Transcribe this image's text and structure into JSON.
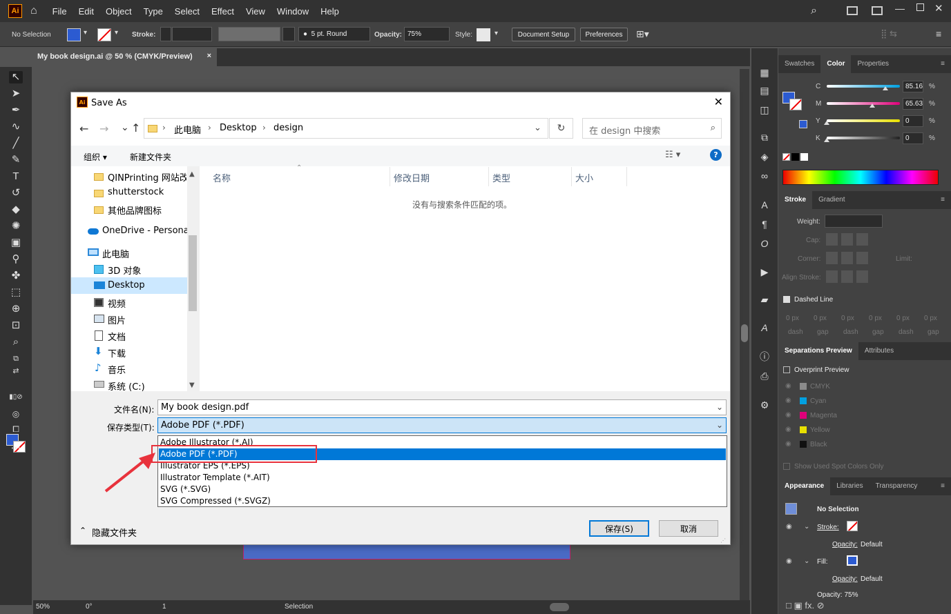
{
  "app": {
    "logo": "Ai",
    "menu": [
      "File",
      "Edit",
      "Object",
      "Type",
      "Select",
      "Effect",
      "View",
      "Window",
      "Help"
    ]
  },
  "control_bar": {
    "selection": "No Selection",
    "stroke_label": "Stroke:",
    "brush": "5 pt. Round",
    "opacity_label": "Opacity:",
    "opacity_value": "75%",
    "style_label": "Style:",
    "document_setup": "Document Setup",
    "preferences": "Preferences",
    "fill_color": "#2c5bd1"
  },
  "document_tab": {
    "title": "My book design.ai @ 50 % (CMYK/Preview)",
    "close": "×"
  },
  "status_bar": {
    "zoom": "50%",
    "rotation": "0°",
    "artboard": "1",
    "tool": "Selection"
  },
  "panels": {
    "color_tabs": [
      "Swatches",
      "Color",
      "Properties"
    ],
    "color": {
      "channels": [
        {
          "k": "C",
          "v": "85.16",
          "c": "#00a0e0"
        },
        {
          "k": "M",
          "v": "65.63",
          "c": "#e0007a"
        },
        {
          "k": "Y",
          "v": "0",
          "c": "#e8e000"
        },
        {
          "k": "K",
          "v": "0",
          "c": "#222222"
        }
      ],
      "unit": "%"
    },
    "stroke_tabs": [
      "Stroke",
      "Gradient"
    ],
    "stroke": {
      "weight": "Weight:",
      "cap": "Cap:",
      "corner": "Corner:",
      "limit": "Limit:",
      "align": "Align Stroke:",
      "dashed": "Dashed Line",
      "dash_vals": [
        "0 px",
        "0 px",
        "0 px",
        "0 px",
        "0 px",
        "0 px"
      ],
      "dash_labels": [
        "dash",
        "gap",
        "dash",
        "gap",
        "dash",
        "gap"
      ]
    },
    "sep_tabs": [
      "Separations Preview",
      "Attributes"
    ],
    "separations": {
      "overprint": "Overprint Preview",
      "inks": [
        {
          "n": "CMYK",
          "c": "#8a8a8a"
        },
        {
          "n": "Cyan",
          "c": "#00a0e0"
        },
        {
          "n": "Magenta",
          "c": "#e0007a"
        },
        {
          "n": "Yellow",
          "c": "#e8e000"
        },
        {
          "n": "Black",
          "c": "#111111"
        }
      ],
      "spot": "Show Used Spot Colors Only"
    },
    "app_tabs": [
      "Appearance",
      "Libraries",
      "Transparency"
    ],
    "appearance": {
      "title": "No Selection",
      "stroke": "Stroke:",
      "opacity": "Opacity:",
      "default": "Default",
      "fill": "Fill:",
      "opacity_bottom": "Opacity: 75%"
    }
  },
  "dialog": {
    "title": "Save As",
    "breadcrumb": [
      "此电脑",
      "Desktop",
      "design"
    ],
    "search_placeholder": "在 design 中搜索",
    "organize": "组织 ▾",
    "new_folder": "新建文件夹",
    "nav_items": [
      "QINPrinting 网站改",
      "shutterstock",
      "其他品牌图标",
      "OneDrive - Personal",
      "此电脑",
      "3D 对象",
      "Desktop",
      "视频",
      "图片",
      "文档",
      "下载",
      "音乐",
      "系统 (C:)"
    ],
    "columns": [
      "名称",
      "修改日期",
      "类型",
      "大小"
    ],
    "empty_message": "没有与搜索条件匹配的项。",
    "filename_label": "文件名(N):",
    "filename_value": "My book design.pdf",
    "type_label": "保存类型(T):",
    "type_value": "Adobe PDF (*.PDF)",
    "type_options": [
      "Adobe Illustrator (*.AI)",
      "Adobe PDF (*.PDF)",
      "Illustrator EPS (*.EPS)",
      "Illustrator Template (*.AIT)",
      "SVG (*.SVG)",
      "SVG Compressed (*.SVGZ)"
    ],
    "selected_option": 1,
    "hide_folders": "隐藏文件夹",
    "save_button": "保存(S)",
    "cancel_button": "取消"
  }
}
